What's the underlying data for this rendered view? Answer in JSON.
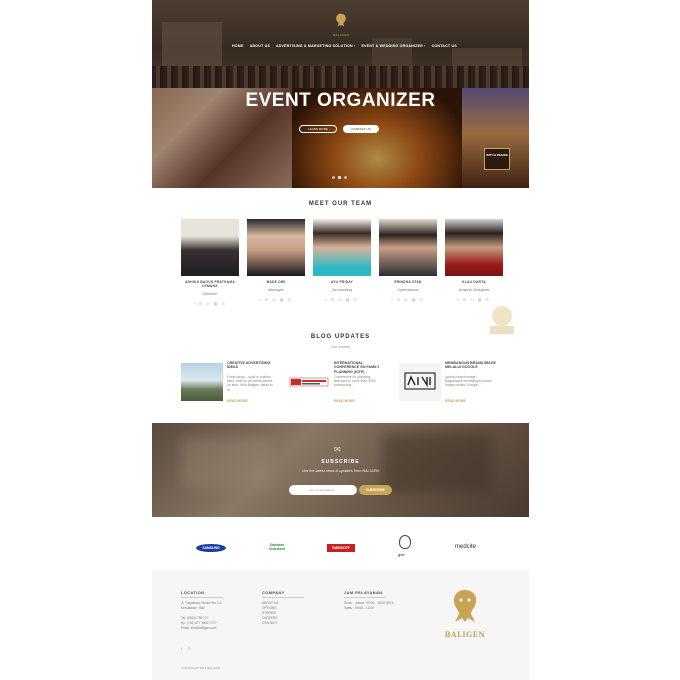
{
  "nav": {
    "brand": "BALIGEN",
    "items": [
      "HOME",
      "ABOUT US",
      "ADVERTISING & MARKETING SOLUTION ›",
      "EVENT & WEDDING ORGANIZER ›",
      "CONTACT US"
    ]
  },
  "hero": {
    "title": "EVENT ORGANIZER",
    "btn_primary": "LEARN MORE",
    "btn_secondary": "CONTACT US",
    "poster_label": "WITCH RESIDE"
  },
  "team": {
    "title": "MEET OUR TEAM",
    "members": [
      {
        "name": "ADHIKA BAGUS PRATHAMA LEMANA",
        "role": "Director",
        "social": "f ✉ ◎ ▦ ✆"
      },
      {
        "name": "MADE DWI",
        "role": "Manager",
        "social": "f ✉ ◎ ▦ ✆"
      },
      {
        "name": "AYU PRIDAY",
        "role": "Accounting",
        "social": "f ✉ ◎ ▦ ✆"
      },
      {
        "name": "ERINDHA STAN",
        "role": "Operational",
        "social": "f ✉ ◎ ▦ ✆"
      },
      {
        "name": "KLAU DARTA",
        "role": "Graphic Designer",
        "social": "f ✉ ◎ ▦ ✆"
      }
    ]
  },
  "blog": {
    "title": "BLOG UPDATES",
    "subtitle": "Our stories",
    "posts": [
      {
        "title": "CREATIVE ADVERTISING IDEAS",
        "excerpt": "Great ideas – solid in outdoor sites, best for all media assets on time. With Baligen, ideas to m...",
        "more": "READ MORE"
      },
      {
        "title": "INTERNATIONAL CONFERENCE ON FAMILY PLANNING (ICFP)",
        "excerpt": "Conference for planning attended to more than 3000 participants...",
        "more": "READ MORE"
      },
      {
        "title": "MEMBANGUN BRAND IMAGE MELALUI GOOGLE",
        "excerpt": "Apa itu brand image? Bagaimana membangun brand image melalui Google...",
        "more": "READ MORE"
      }
    ]
  },
  "subscribe": {
    "title": "SUBSCRIBE",
    "text": "Get the latest news & updates from BALIGEN",
    "placeholder": "your email address",
    "button": "SUBSCRIBE"
  },
  "clients": [
    "SAMSUNG",
    "Standard Chartered",
    "SMIRNOFF",
    "gcd",
    "medcite"
  ],
  "footer": {
    "location_h": "LOCATION",
    "location": [
      "Jl. Tunjakulan Teruko No.7 A",
      "Kerobokan · Bali",
      "Tel. (0361) 755 ???",
      "Hp. (+62) 877 9802 ????",
      "Email. info@baligen.com"
    ],
    "company_h": "COMPANY",
    "company": [
      "ABOUT US",
      "OPTIONS",
      "STORIES",
      "CAREERS",
      "CONTACT"
    ],
    "hours_h": "JAM PELAYANAN",
    "hours": [
      "Senin - Jumat : 09:00 - 18:00 WITA",
      "Sabtu : 09:00 - 13:00"
    ],
    "brand": "BALIGEN",
    "copyright": "COPYRIGHT 2015 BALIGEN",
    "social": "f ◎"
  },
  "colors": {
    "accent": "#c9a455",
    "footer_bg": "#f6f6f6"
  }
}
